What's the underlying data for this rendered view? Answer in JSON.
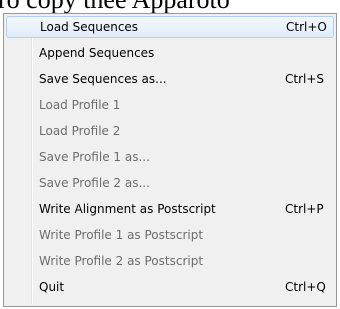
{
  "background_text": "ro copy thee Apparoto",
  "menu": {
    "items": [
      {
        "label": "Load Sequences",
        "shortcut": "Ctrl+O",
        "enabled": true
      },
      {
        "label": "Append Sequences",
        "shortcut": "",
        "enabled": true
      },
      {
        "label": "Save Sequences as...",
        "shortcut": "Ctrl+S",
        "enabled": true
      },
      {
        "label": "Load Profile 1",
        "shortcut": "",
        "enabled": false
      },
      {
        "label": "Load Profile 2",
        "shortcut": "",
        "enabled": false
      },
      {
        "label": "Save Profile 1 as...",
        "shortcut": "",
        "enabled": false
      },
      {
        "label": "Save Profile 2 as...",
        "shortcut": "",
        "enabled": false
      },
      {
        "label": "Write Alignment as Postscript",
        "shortcut": "Ctrl+P",
        "enabled": true
      },
      {
        "label": "Write Profile 1 as Postscript",
        "shortcut": "",
        "enabled": false
      },
      {
        "label": "Write Profile 2 as Postscript",
        "shortcut": "",
        "enabled": false
      },
      {
        "label": "Quit",
        "shortcut": "Ctrl+Q",
        "enabled": true
      }
    ]
  },
  "colors": {
    "menu_background": "#f0f0f0",
    "menu_border": "#979797",
    "disabled_text": "#6d6d6d",
    "highlight_border": "#aecff7"
  }
}
